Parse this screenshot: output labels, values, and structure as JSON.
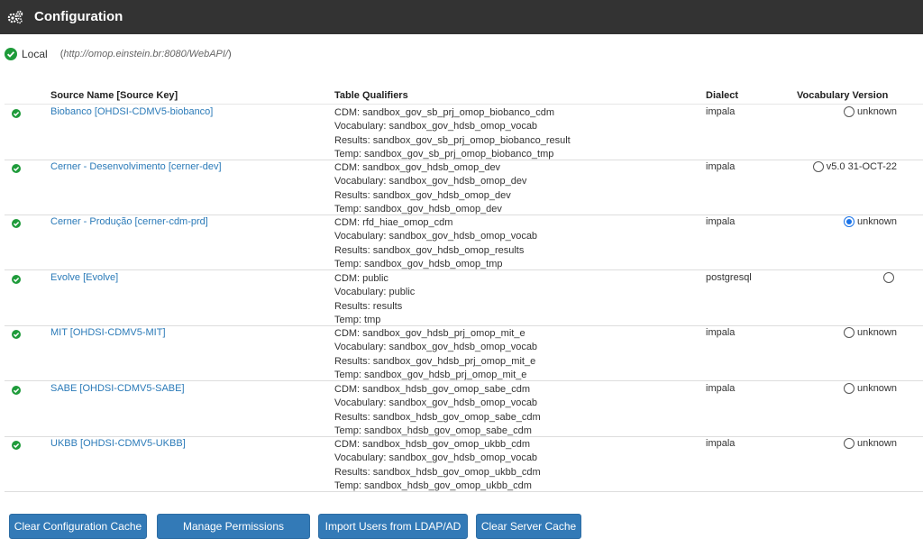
{
  "header": {
    "title": "Configuration",
    "icon": "gears-icon"
  },
  "local": {
    "label": "Local",
    "url": "http://omop.einstein.br:8080/WebAPI/",
    "open_paren": "(",
    "close_paren": ")"
  },
  "columns": {
    "source": "Source Name [Source Key]",
    "qualifiers": "Table Qualifiers",
    "dialect": "Dialect",
    "vocab": "Vocabulary Version"
  },
  "rows": [
    {
      "source": "Biobanco [OHDSI-CDMV5-biobanco]",
      "cdm": "CDM: sandbox_gov_sb_prj_omop_biobanco_cdm",
      "vocabulary": "Vocabulary: sandbox_gov_hdsb_omop_vocab",
      "results": "Results: sandbox_gov_sb_prj_omop_biobanco_result",
      "temp": "Temp: sandbox_gov_sb_prj_omop_biobanco_tmp",
      "dialect": "impala",
      "vocab_version": "unknown",
      "selected": false
    },
    {
      "source": "Cerner - Desenvolvimento [cerner-dev]",
      "cdm": "CDM: sandbox_gov_hdsb_omop_dev",
      "vocabulary": "Vocabulary: sandbox_gov_hdsb_omop_dev",
      "results": "Results: sandbox_gov_hdsb_omop_dev",
      "temp": "Temp: sandbox_gov_hdsb_omop_dev",
      "dialect": "impala",
      "vocab_version": "v5.0 31-OCT-22",
      "selected": false
    },
    {
      "source": "Cerner - Produção [cerner-cdm-prd]",
      "cdm": "CDM: rfd_hiae_omop_cdm",
      "vocabulary": "Vocabulary: sandbox_gov_hdsb_omop_vocab",
      "results": "Results: sandbox_gov_hdsb_omop_results",
      "temp": "Temp: sandbox_gov_hdsb_omop_tmp",
      "dialect": "impala",
      "vocab_version": "unknown",
      "selected": true
    },
    {
      "source": "Evolve [Evolve]",
      "cdm": "CDM: public",
      "vocabulary": "Vocabulary: public",
      "results": "Results: results",
      "temp": "Temp: tmp",
      "dialect": "postgresql",
      "vocab_version": "",
      "selected": false
    },
    {
      "source": "MIT [OHDSI-CDMV5-MIT]",
      "cdm": "CDM: sandbox_gov_hdsb_prj_omop_mit_e",
      "vocabulary": "Vocabulary: sandbox_gov_hdsb_omop_vocab",
      "results": "Results: sandbox_gov_hdsb_prj_omop_mit_e",
      "temp": "Temp: sandbox_gov_hdsb_prj_omop_mit_e",
      "dialect": "impala",
      "vocab_version": "unknown",
      "selected": false
    },
    {
      "source": "SABE [OHDSI-CDMV5-SABE]",
      "cdm": "CDM: sandbox_hdsb_gov_omop_sabe_cdm",
      "vocabulary": "Vocabulary: sandbox_gov_hdsb_omop_vocab",
      "results": "Results: sandbox_hdsb_gov_omop_sabe_cdm",
      "temp": "Temp: sandbox_hdsb_gov_omop_sabe_cdm",
      "dialect": "impala",
      "vocab_version": "unknown",
      "selected": false
    },
    {
      "source": "UKBB [OHDSI-CDMV5-UKBB]",
      "cdm": "CDM: sandbox_hdsb_gov_omop_ukbb_cdm",
      "vocabulary": "Vocabulary: sandbox_gov_hdsb_omop_vocab",
      "results": "Results: sandbox_hdsb_gov_omop_ukbb_cdm",
      "temp": "Temp: sandbox_hdsb_gov_omop_ukbb_cdm",
      "dialect": "impala",
      "vocab_version": "unknown",
      "selected": false
    }
  ],
  "buttons": {
    "clear_config": "Clear Configuration Cache",
    "manage_permissions": "Manage Permissions",
    "import_ldap": "Import Users from LDAP/AD",
    "clear_server": "Clear Server Cache"
  },
  "colors": {
    "header_bg": "#333333",
    "link": "#2a7ab8",
    "check": "#1e9b3a",
    "button": "#337ab7",
    "radio_selected": "#1a73e8"
  }
}
